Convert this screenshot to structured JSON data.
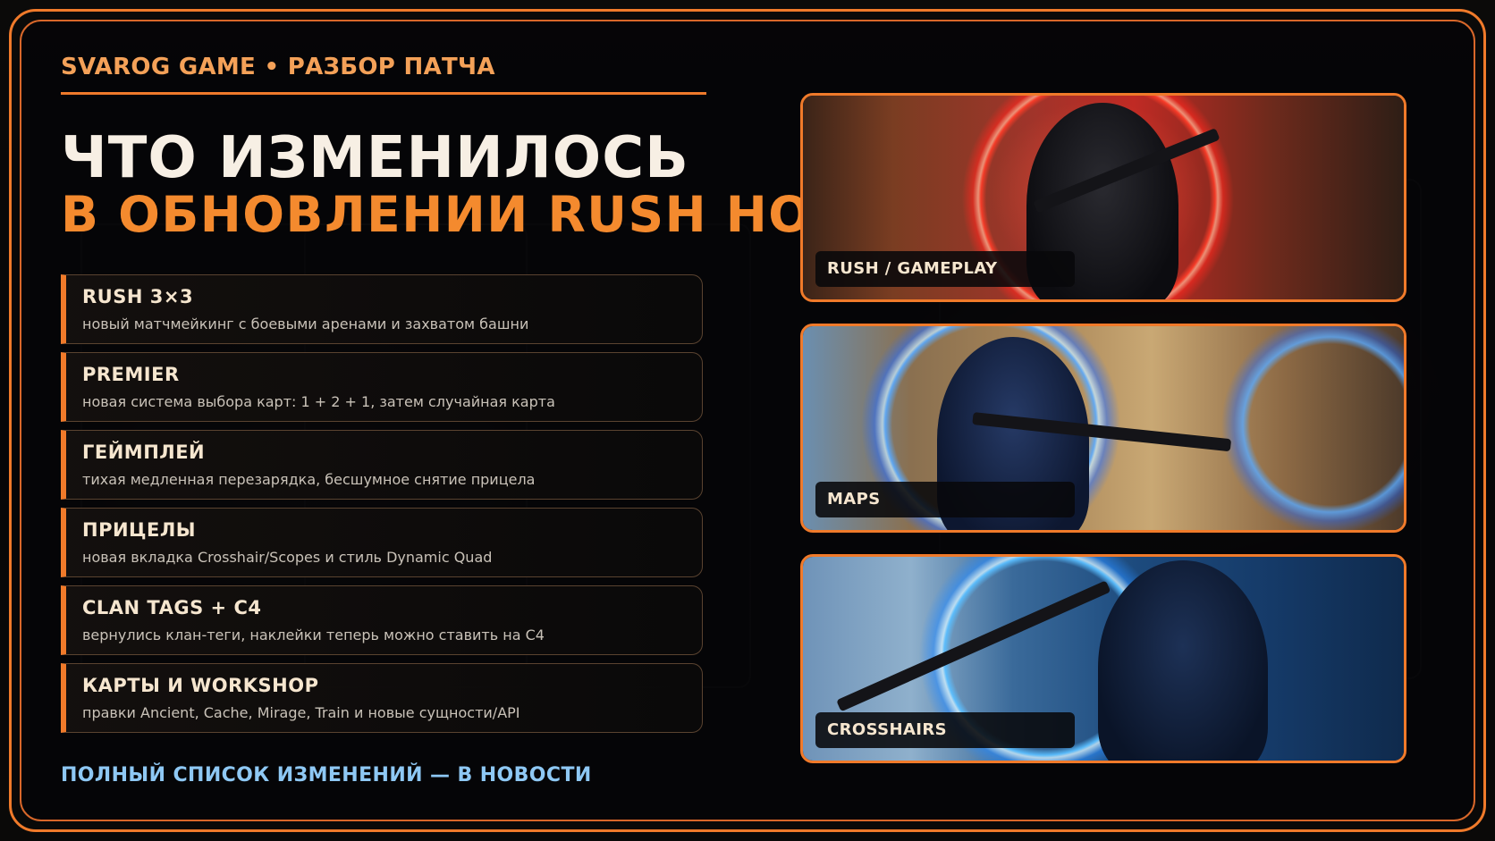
{
  "header": {
    "kicker": "SVAROG GAME • РАЗБОР ПАТЧА",
    "title_line1": "ЧТО ИЗМЕНИЛОСЬ",
    "title_line2": "В ОБНОВЛЕНИИ RUSH HOUR"
  },
  "changes": [
    {
      "title": "RUSH 3×3",
      "description": "новый матчмейкинг с боевыми аренами и захватом башни"
    },
    {
      "title": "PREMIER",
      "description": "новая система выбора карт: 1 + 2 + 1, затем случайная карта"
    },
    {
      "title": "ГЕЙМПЛЕЙ",
      "description": "тихая медленная перезарядка, бесшумное снятие прицела"
    },
    {
      "title": "ПРИЦЕЛЫ",
      "description": "новая вкладка Crosshair/Scopes и стиль Dynamic Quad"
    },
    {
      "title": "CLAN TAGS + C4",
      "description": "вернулись клан-теги, наклейки теперь можно ставить на C4"
    },
    {
      "title": "КАРТЫ И WORKSHOP",
      "description": "правки Ancient, Cache, Mirage, Train и новые сущности/API"
    }
  ],
  "cta": "ПОЛНЫЙ СПИСОК ИЗМЕНЕНИЙ — В НОВОСТИ",
  "cards": [
    {
      "label": "RUSH / GAMEPLAY"
    },
    {
      "label": "MAPS"
    },
    {
      "label": "CROSSHAIRS"
    }
  ],
  "colors": {
    "accent": "#f07a2a",
    "title_light": "#f7efe4",
    "title_accent": "#f48a2e",
    "kicker": "#f4a158",
    "cta": "#8ec8f4"
  }
}
